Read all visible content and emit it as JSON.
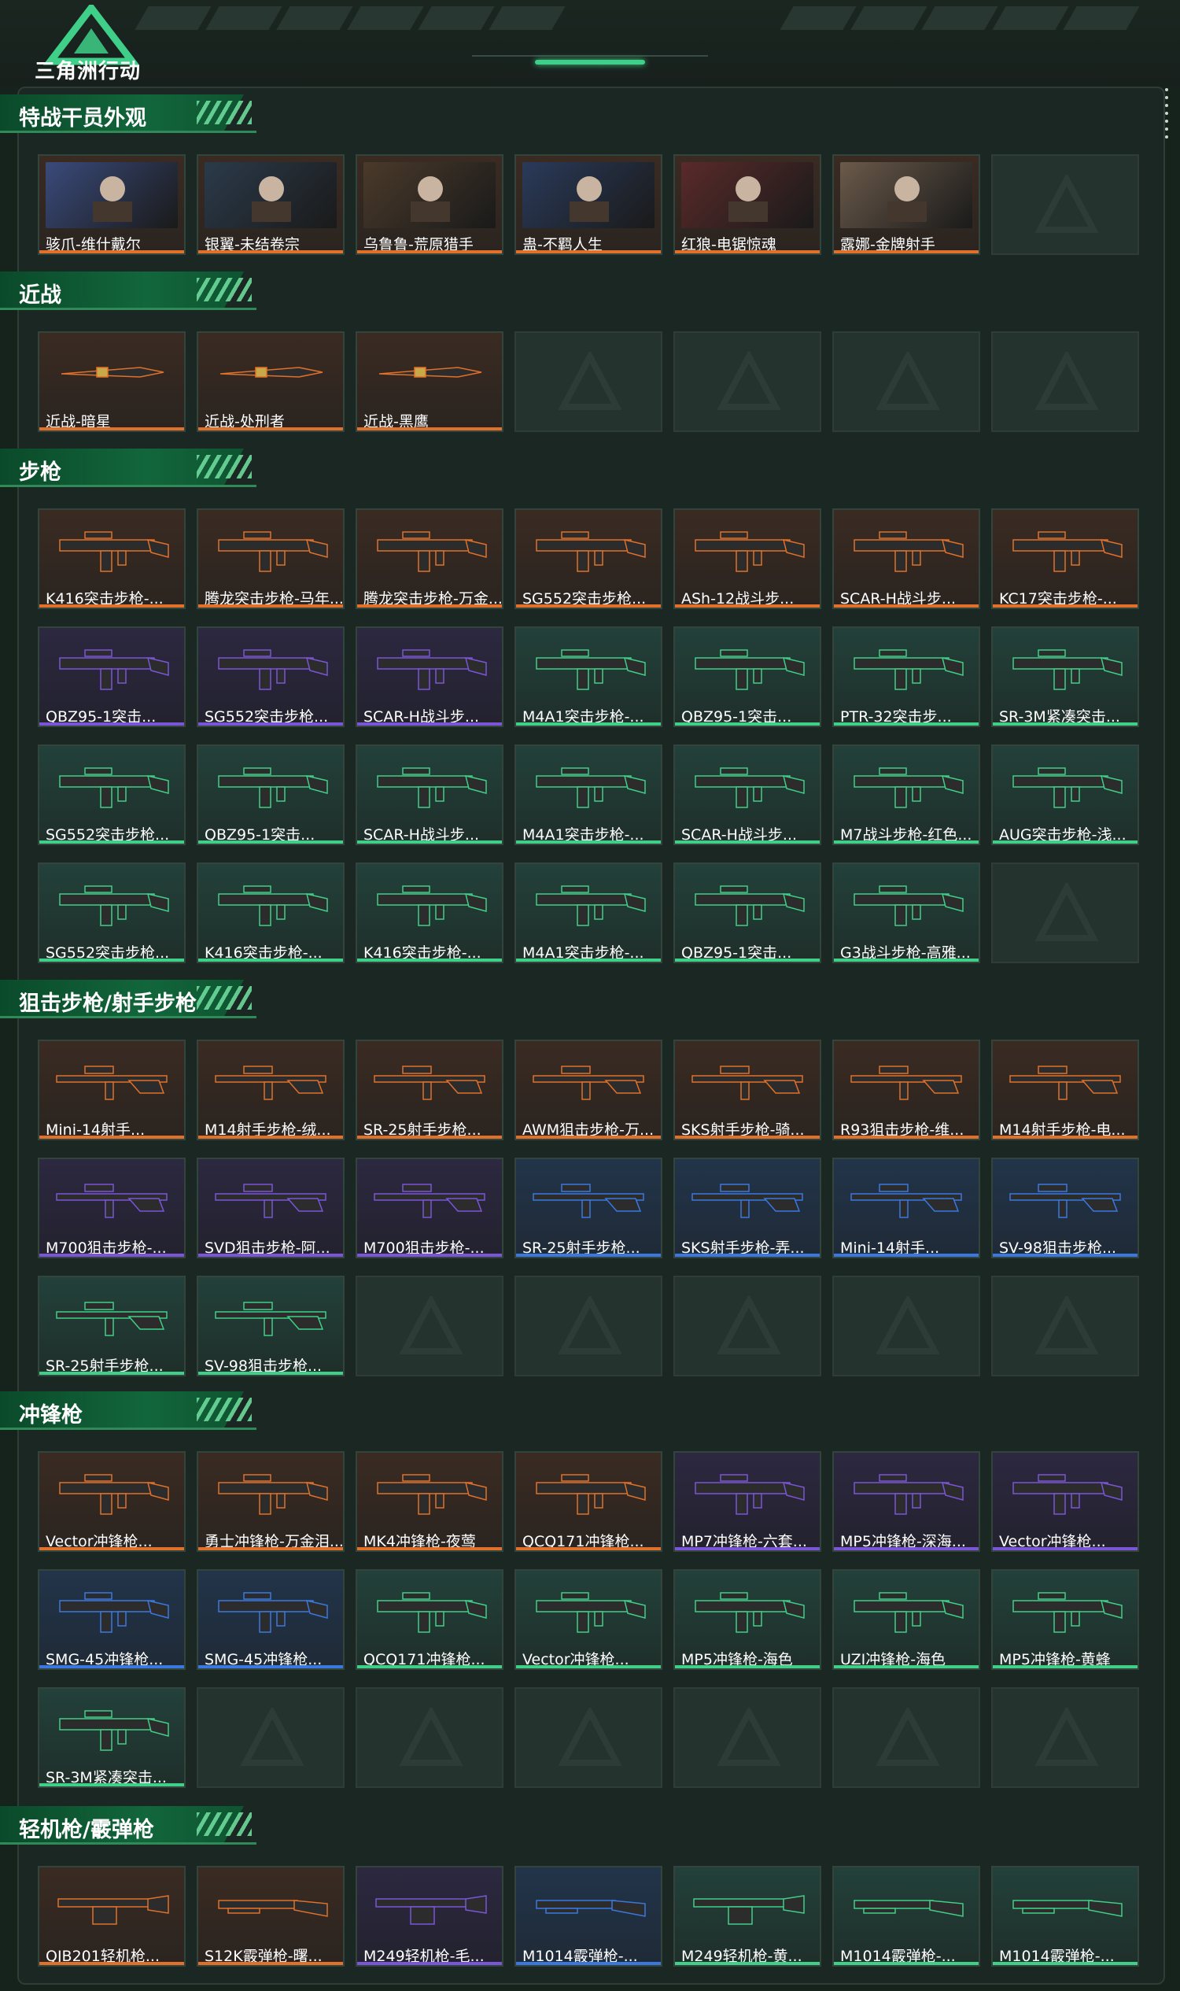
{
  "app": {
    "logo_text": "三角洲行动"
  },
  "colors": {
    "orange": "#e0702a",
    "purple": "#7a55d8",
    "blue": "#3a78e0",
    "green": "#3fcf88"
  },
  "sections": [
    {
      "title": "特战干员外观",
      "rows": [
        [
          {
            "label": "骇爪-维什戴尔",
            "rarity": "orange",
            "icon": "operator-portrait"
          },
          {
            "label": "银翼-未结卷宗",
            "rarity": "orange",
            "icon": "operator-portrait"
          },
          {
            "label": "乌鲁鲁-荒原猎手",
            "rarity": "orange",
            "icon": "operator-portrait"
          },
          {
            "label": "蛊-不羁人生",
            "rarity": "orange",
            "icon": "operator-portrait"
          },
          {
            "label": "红狼-电锯惊魂",
            "rarity": "orange",
            "icon": "operator-portrait"
          },
          {
            "label": "露娜-金牌射手",
            "rarity": "orange",
            "icon": "operator-portrait"
          },
          null
        ]
      ]
    },
    {
      "title": "近战",
      "rows": [
        [
          {
            "label": "近战-暗星",
            "rarity": "orange",
            "icon": "knife"
          },
          {
            "label": "近战-处刑者",
            "rarity": "orange",
            "icon": "knife"
          },
          {
            "label": "近战-黑鹰",
            "rarity": "orange",
            "icon": "knife"
          },
          null,
          null,
          null,
          null
        ]
      ]
    },
    {
      "title": "步枪",
      "rows": [
        [
          {
            "label": "K416突击步枪-...",
            "rarity": "orange",
            "icon": "rifle"
          },
          {
            "label": "腾龙突击步枪-马年...",
            "rarity": "orange",
            "icon": "rifle"
          },
          {
            "label": "腾龙突击步枪-万金...",
            "rarity": "orange",
            "icon": "rifle"
          },
          {
            "label": "SG552突击步枪...",
            "rarity": "orange",
            "icon": "rifle"
          },
          {
            "label": "ASh-12战斗步...",
            "rarity": "orange",
            "icon": "rifle"
          },
          {
            "label": "SCAR-H战斗步...",
            "rarity": "orange",
            "icon": "rifle"
          },
          {
            "label": "KC17突击步枪-...",
            "rarity": "orange",
            "icon": "rifle"
          }
        ],
        [
          {
            "label": "QBZ95-1突击...",
            "rarity": "purple",
            "icon": "rifle"
          },
          {
            "label": "SG552突击步枪...",
            "rarity": "purple",
            "icon": "rifle"
          },
          {
            "label": "SCAR-H战斗步...",
            "rarity": "purple",
            "icon": "rifle"
          },
          {
            "label": "M4A1突击步枪-...",
            "rarity": "green",
            "icon": "rifle"
          },
          {
            "label": "QBZ95-1突击...",
            "rarity": "green",
            "icon": "rifle"
          },
          {
            "label": "PTR-32突击步...",
            "rarity": "green",
            "icon": "rifle"
          },
          {
            "label": "SR-3M紧凑突击...",
            "rarity": "green",
            "icon": "rifle"
          }
        ],
        [
          {
            "label": "SG552突击步枪...",
            "rarity": "green",
            "icon": "rifle"
          },
          {
            "label": "QBZ95-1突击...",
            "rarity": "green",
            "icon": "rifle"
          },
          {
            "label": "SCAR-H战斗步...",
            "rarity": "green",
            "icon": "rifle"
          },
          {
            "label": "M4A1突击步枪-...",
            "rarity": "green",
            "icon": "rifle"
          },
          {
            "label": "SCAR-H战斗步...",
            "rarity": "green",
            "icon": "rifle"
          },
          {
            "label": "M7战斗步枪-红色...",
            "rarity": "green",
            "icon": "rifle"
          },
          {
            "label": "AUG突击步枪-浅...",
            "rarity": "green",
            "icon": "rifle"
          }
        ],
        [
          {
            "label": "SG552突击步枪...",
            "rarity": "green",
            "icon": "rifle"
          },
          {
            "label": "K416突击步枪-...",
            "rarity": "green",
            "icon": "rifle"
          },
          {
            "label": "K416突击步枪-...",
            "rarity": "green",
            "icon": "rifle"
          },
          {
            "label": "M4A1突击步枪-...",
            "rarity": "green",
            "icon": "rifle"
          },
          {
            "label": "QBZ95-1突击...",
            "rarity": "green",
            "icon": "rifle"
          },
          {
            "label": "G3战斗步枪-高雅...",
            "rarity": "green",
            "icon": "rifle"
          },
          null
        ]
      ]
    },
    {
      "title": "狙击步枪/射手步枪",
      "rows": [
        [
          {
            "label": "Mini-14射手...",
            "rarity": "orange",
            "icon": "sniper"
          },
          {
            "label": "M14射手步枪-绒...",
            "rarity": "orange",
            "icon": "sniper"
          },
          {
            "label": "SR-25射手步枪...",
            "rarity": "orange",
            "icon": "sniper"
          },
          {
            "label": "AWM狙击步枪-万...",
            "rarity": "orange",
            "icon": "sniper"
          },
          {
            "label": "SKS射手步枪-骑...",
            "rarity": "orange",
            "icon": "sniper"
          },
          {
            "label": "R93狙击步枪-维...",
            "rarity": "orange",
            "icon": "sniper"
          },
          {
            "label": "M14射手步枪-电...",
            "rarity": "orange",
            "icon": "sniper"
          }
        ],
        [
          {
            "label": "M700狙击步枪-...",
            "rarity": "purple",
            "icon": "sniper"
          },
          {
            "label": "SVD狙击步枪-阿...",
            "rarity": "purple",
            "icon": "sniper"
          },
          {
            "label": "M700狙击步枪-...",
            "rarity": "purple",
            "icon": "sniper"
          },
          {
            "label": "SR-25射手步枪...",
            "rarity": "blue",
            "icon": "sniper"
          },
          {
            "label": "SKS射手步枪-弄...",
            "rarity": "blue",
            "icon": "sniper"
          },
          {
            "label": "Mini-14射手...",
            "rarity": "blue",
            "icon": "sniper"
          },
          {
            "label": "SV-98狙击步枪...",
            "rarity": "blue",
            "icon": "sniper"
          }
        ],
        [
          {
            "label": "SR-25射手步枪...",
            "rarity": "green",
            "icon": "sniper"
          },
          {
            "label": "SV-98狙击步枪...",
            "rarity": "green",
            "icon": "sniper"
          },
          null,
          null,
          null,
          null,
          null
        ]
      ]
    },
    {
      "title": "冲锋枪",
      "rows": [
        [
          {
            "label": "Vector冲锋枪...",
            "rarity": "orange",
            "icon": "smg"
          },
          {
            "label": "勇士冲锋枪-万金泪...",
            "rarity": "orange",
            "icon": "smg"
          },
          {
            "label": "MK4冲锋枪-夜莺",
            "rarity": "orange",
            "icon": "smg"
          },
          {
            "label": "QCQ171冲锋枪...",
            "rarity": "orange",
            "icon": "smg"
          },
          {
            "label": "MP7冲锋枪-六套...",
            "rarity": "purple",
            "icon": "smg"
          },
          {
            "label": "MP5冲锋枪-深海...",
            "rarity": "purple",
            "icon": "smg"
          },
          {
            "label": "Vector冲锋枪...",
            "rarity": "purple",
            "icon": "smg"
          }
        ],
        [
          {
            "label": "SMG-45冲锋枪...",
            "rarity": "blue",
            "icon": "smg"
          },
          {
            "label": "SMG-45冲锋枪...",
            "rarity": "blue",
            "icon": "smg"
          },
          {
            "label": "QCQ171冲锋枪...",
            "rarity": "green",
            "icon": "smg"
          },
          {
            "label": "Vector冲锋枪...",
            "rarity": "green",
            "icon": "smg"
          },
          {
            "label": "MP5冲锋枪-海色",
            "rarity": "green",
            "icon": "smg"
          },
          {
            "label": "UZI冲锋枪-海色",
            "rarity": "green",
            "icon": "smg"
          },
          {
            "label": "MP5冲锋枪-黄蜂",
            "rarity": "green",
            "icon": "smg"
          }
        ],
        [
          {
            "label": "SR-3M紧凑突击...",
            "rarity": "green",
            "icon": "smg"
          },
          null,
          null,
          null,
          null,
          null,
          null
        ]
      ]
    },
    {
      "title": "轻机枪/霰弹枪",
      "rows": [
        [
          {
            "label": "QJB201轻机枪...",
            "rarity": "orange",
            "icon": "lmg"
          },
          {
            "label": "S12K霰弹枪-曙...",
            "rarity": "orange",
            "icon": "shotgun"
          },
          {
            "label": "M249轻机枪-毛...",
            "rarity": "purple",
            "icon": "lmg"
          },
          {
            "label": "M1014霰弹枪-...",
            "rarity": "blue",
            "icon": "shotgun"
          },
          {
            "label": "M249轻机枪-黄...",
            "rarity": "green",
            "icon": "lmg"
          },
          {
            "label": "M1014霰弹枪-...",
            "rarity": "green",
            "icon": "shotgun"
          },
          {
            "label": "M1014霰弹枪-...",
            "rarity": "green",
            "icon": "shotgun"
          }
        ]
      ]
    }
  ]
}
